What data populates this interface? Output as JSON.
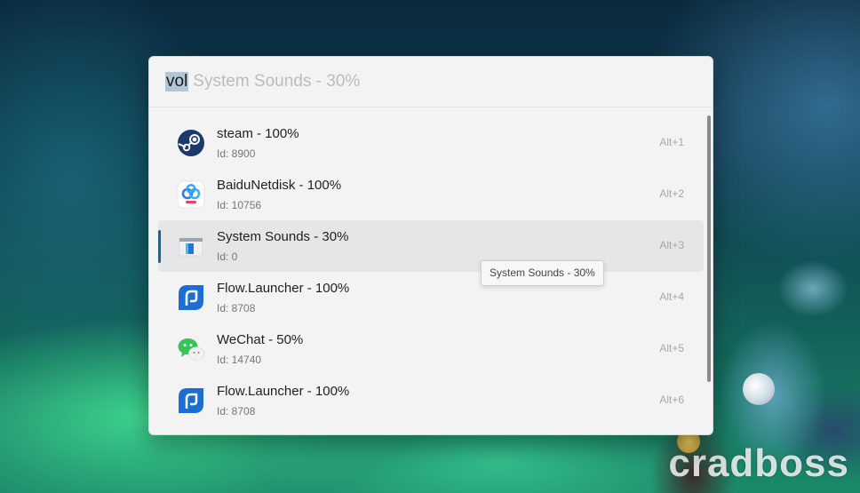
{
  "search": {
    "typed": "vol",
    "suggestion": "System Sounds - 30%"
  },
  "results": [
    {
      "title": "steam - 100%",
      "subtitle": "Id: 8900",
      "hotkey": "Alt+1",
      "icon": "steam-icon"
    },
    {
      "title": "BaiduNetdisk - 100%",
      "subtitle": "Id: 10756",
      "hotkey": "Alt+2",
      "icon": "baidunetdisk-icon"
    },
    {
      "title": "System Sounds - 30%",
      "subtitle": "Id: 0",
      "hotkey": "Alt+3",
      "icon": "system-sounds-icon",
      "selected": true
    },
    {
      "title": "Flow.Launcher - 100%",
      "subtitle": "Id: 8708",
      "hotkey": "Alt+4",
      "icon": "flow-launcher-icon"
    },
    {
      "title": "WeChat - 50%",
      "subtitle": "Id: 14740",
      "hotkey": "Alt+5",
      "icon": "wechat-icon"
    },
    {
      "title": "Flow.Launcher - 100%",
      "subtitle": "Id: 8708",
      "hotkey": "Alt+6",
      "icon": "flow-launcher-icon"
    }
  ],
  "tooltip": {
    "text": "System Sounds - 30%"
  },
  "watermark": "cradboss",
  "colors": {
    "accent": "#2f5f7f",
    "selected_row": "#e6e6e6",
    "panel": "#f3f3f3"
  }
}
